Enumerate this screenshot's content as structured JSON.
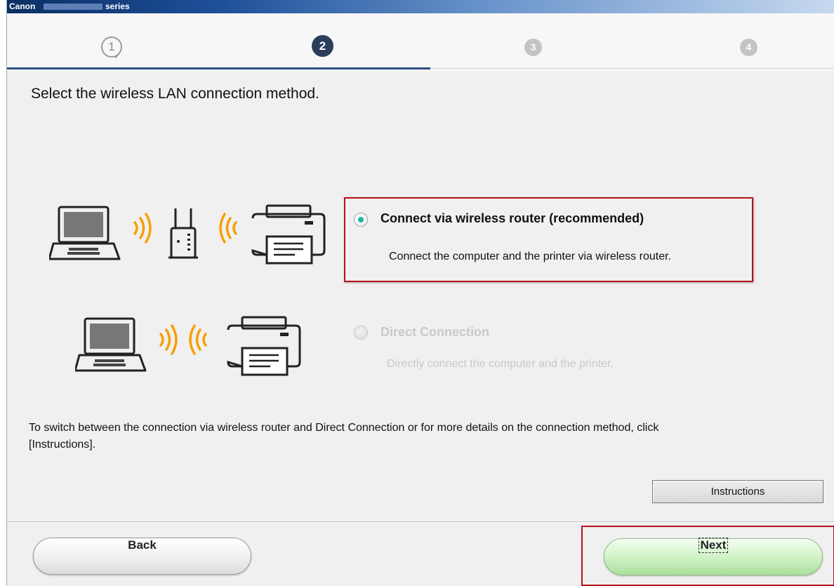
{
  "titlebar": {
    "brand": "Canon",
    "series": "series"
  },
  "steps": [
    {
      "label": "1",
      "state": "done"
    },
    {
      "label": "2",
      "state": "active"
    },
    {
      "label": "3",
      "state": "pending"
    },
    {
      "label": "4",
      "state": "pending"
    }
  ],
  "main": {
    "heading": "Select the wireless LAN connection method.",
    "options": [
      {
        "title": "Connect via wireless router (recommended)",
        "description": "Connect the computer and the printer via wireless router.",
        "selected": true,
        "enabled": true
      },
      {
        "title": "Direct Connection",
        "description": "Directly connect the computer and the printer.",
        "selected": false,
        "enabled": false
      }
    ],
    "note_line1": "To switch between the connection via wireless router and Direct Connection or for more details on the connection method, click",
    "note_line2": "[Instructions].",
    "instructions_label": "Instructions"
  },
  "footer": {
    "back_label": "Back",
    "next_label": "Next"
  },
  "colors": {
    "accent_wifi": "#f5a000",
    "highlight_border": "#b5121b",
    "radio_selected": "#1fb59e",
    "next_green": "#bfeab3",
    "step_active": "#2a3e5c"
  },
  "icons": [
    "laptop-icon",
    "wifi-waves-icon",
    "router-icon",
    "printer-icon",
    "check-icon"
  ]
}
